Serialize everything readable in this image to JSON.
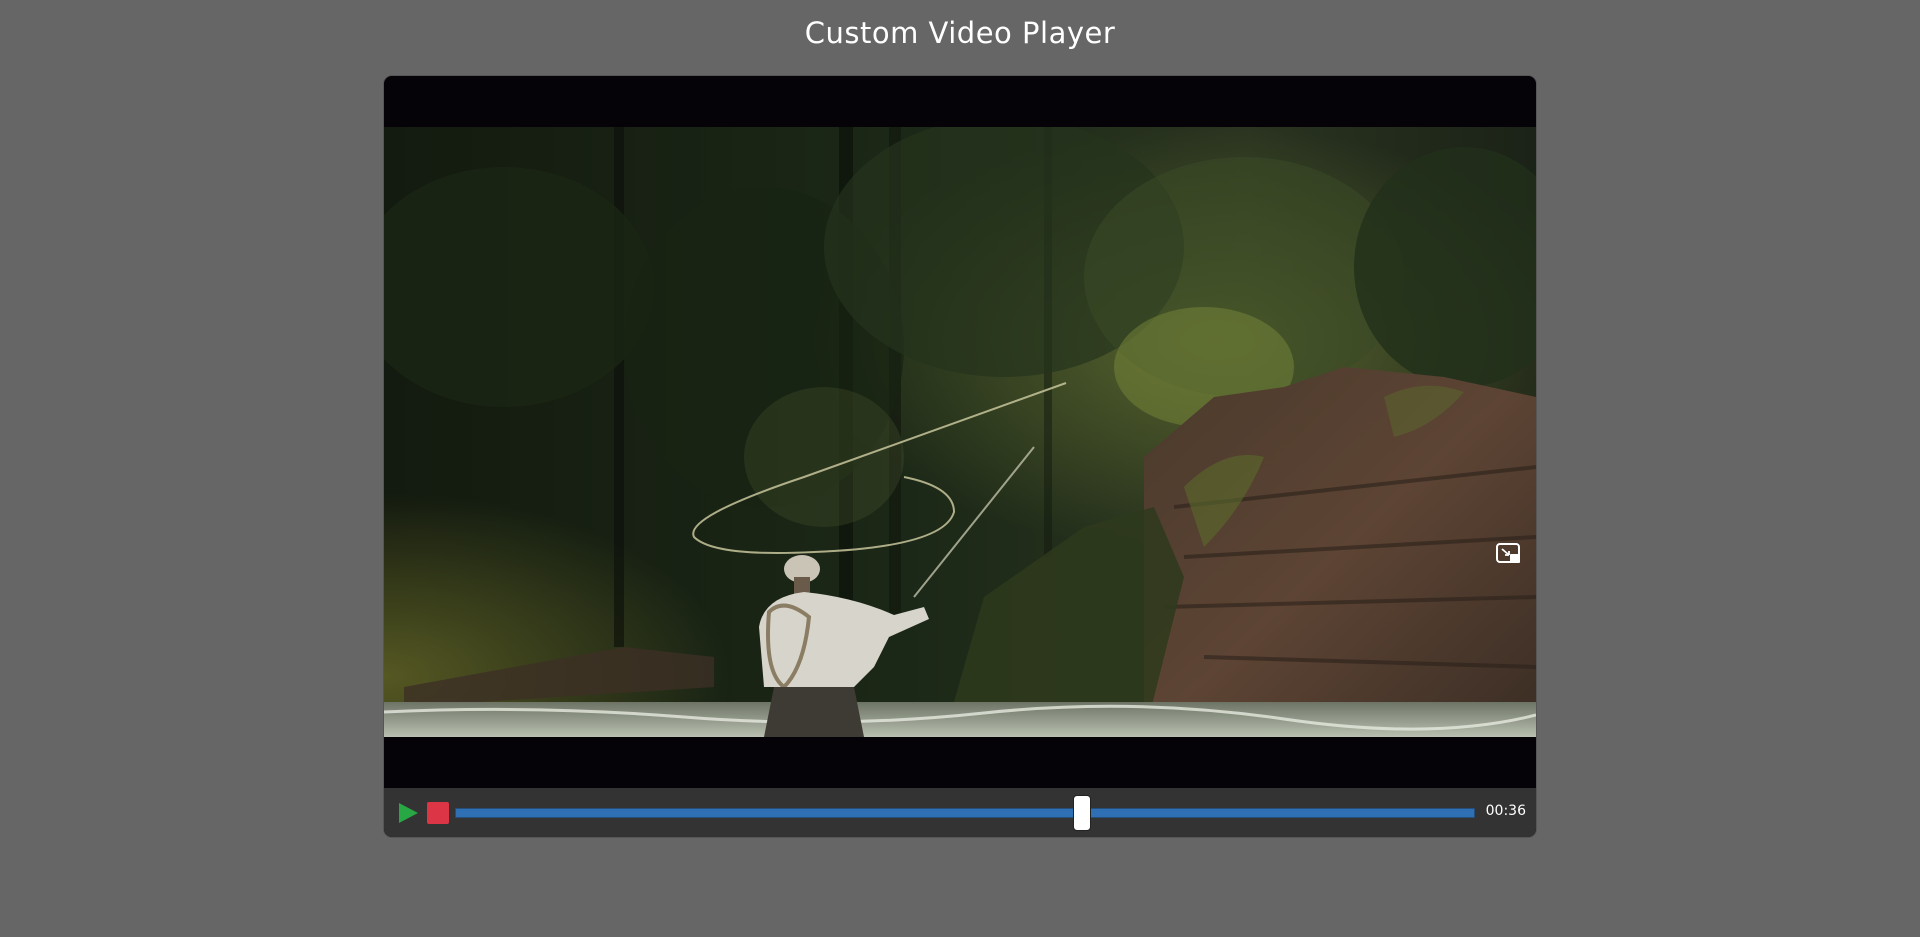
{
  "page": {
    "title": "Custom Video Player"
  },
  "player": {
    "video_description": "fly-fishing",
    "controls": {
      "play_icon": "play-icon",
      "stop_icon": "stop-icon",
      "pip_icon": "picture-in-picture-icon",
      "progress": 0.615,
      "time": "00:36"
    },
    "colors": {
      "play": "#28a745",
      "stop": "#dc3545",
      "progress_track": "#2f6fb3",
      "controls_bg": "#333333",
      "page_bg": "#666666"
    }
  }
}
